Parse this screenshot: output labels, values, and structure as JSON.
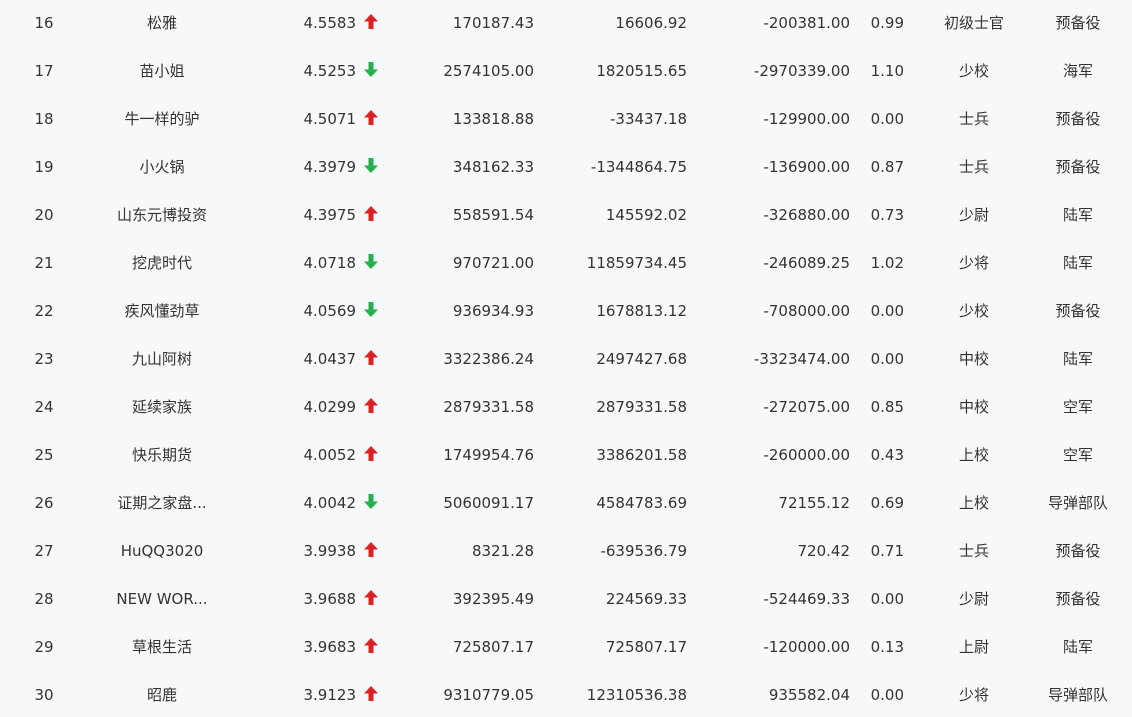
{
  "colors": {
    "up": "#e02020",
    "down": "#22b14c",
    "text": "#333333",
    "background": "#f7f8fa"
  },
  "rows": [
    {
      "rank": "16",
      "name": "松雅",
      "score": "4.5583",
      "trend": "up",
      "v1": "170187.43",
      "v2": "16606.92",
      "v3": "-200381.00",
      "ratio": "0.99",
      "level": "初级士官",
      "branch": "预备役"
    },
    {
      "rank": "17",
      "name": "苗小姐",
      "score": "4.5253",
      "trend": "down",
      "v1": "2574105.00",
      "v2": "1820515.65",
      "v3": "-2970339.00",
      "ratio": "1.10",
      "level": "少校",
      "branch": "海军"
    },
    {
      "rank": "18",
      "name": "牛一样的驴",
      "score": "4.5071",
      "trend": "up",
      "v1": "133818.88",
      "v2": "-33437.18",
      "v3": "-129900.00",
      "ratio": "0.00",
      "level": "士兵",
      "branch": "预备役"
    },
    {
      "rank": "19",
      "name": "小火锅",
      "score": "4.3979",
      "trend": "down",
      "v1": "348162.33",
      "v2": "-1344864.75",
      "v3": "-136900.00",
      "ratio": "0.87",
      "level": "士兵",
      "branch": "预备役"
    },
    {
      "rank": "20",
      "name": "山东元博投资",
      "score": "4.3975",
      "trend": "up",
      "v1": "558591.54",
      "v2": "145592.02",
      "v3": "-326880.00",
      "ratio": "0.73",
      "level": "少尉",
      "branch": "陆军"
    },
    {
      "rank": "21",
      "name": "挖虎时代",
      "score": "4.0718",
      "trend": "down",
      "v1": "970721.00",
      "v2": "11859734.45",
      "v3": "-246089.25",
      "ratio": "1.02",
      "level": "少将",
      "branch": "陆军"
    },
    {
      "rank": "22",
      "name": "疾风懂劲草",
      "score": "4.0569",
      "trend": "down",
      "v1": "936934.93",
      "v2": "1678813.12",
      "v3": "-708000.00",
      "ratio": "0.00",
      "level": "少校",
      "branch": "预备役"
    },
    {
      "rank": "23",
      "name": "九山阿树",
      "score": "4.0437",
      "trend": "up",
      "v1": "3322386.24",
      "v2": "2497427.68",
      "v3": "-3323474.00",
      "ratio": "0.00",
      "level": "中校",
      "branch": "陆军"
    },
    {
      "rank": "24",
      "name": "延续家族",
      "score": "4.0299",
      "trend": "up",
      "v1": "2879331.58",
      "v2": "2879331.58",
      "v3": "-272075.00",
      "ratio": "0.85",
      "level": "中校",
      "branch": "空军"
    },
    {
      "rank": "25",
      "name": "快乐期货",
      "score": "4.0052",
      "trend": "up",
      "v1": "1749954.76",
      "v2": "3386201.58",
      "v3": "-260000.00",
      "ratio": "0.43",
      "level": "上校",
      "branch": "空军"
    },
    {
      "rank": "26",
      "name": "证期之家盘...",
      "score": "4.0042",
      "trend": "down",
      "v1": "5060091.17",
      "v2": "4584783.69",
      "v3": "72155.12",
      "ratio": "0.69",
      "level": "上校",
      "branch": "导弹部队"
    },
    {
      "rank": "27",
      "name": "HuQQ3020",
      "score": "3.9938",
      "trend": "up",
      "v1": "8321.28",
      "v2": "-639536.79",
      "v3": "720.42",
      "ratio": "0.71",
      "level": "士兵",
      "branch": "预备役"
    },
    {
      "rank": "28",
      "name": "NEW WOR...",
      "score": "3.9688",
      "trend": "up",
      "v1": "392395.49",
      "v2": "224569.33",
      "v3": "-524469.33",
      "ratio": "0.00",
      "level": "少尉",
      "branch": "预备役"
    },
    {
      "rank": "29",
      "name": "草根生活",
      "score": "3.9683",
      "trend": "up",
      "v1": "725807.17",
      "v2": "725807.17",
      "v3": "-120000.00",
      "ratio": "0.13",
      "level": "上尉",
      "branch": "陆军"
    },
    {
      "rank": "30",
      "name": "昭鹿",
      "score": "3.9123",
      "trend": "up",
      "v1": "9310779.05",
      "v2": "12310536.38",
      "v3": "935582.04",
      "ratio": "0.00",
      "level": "少将",
      "branch": "导弹部队"
    }
  ]
}
